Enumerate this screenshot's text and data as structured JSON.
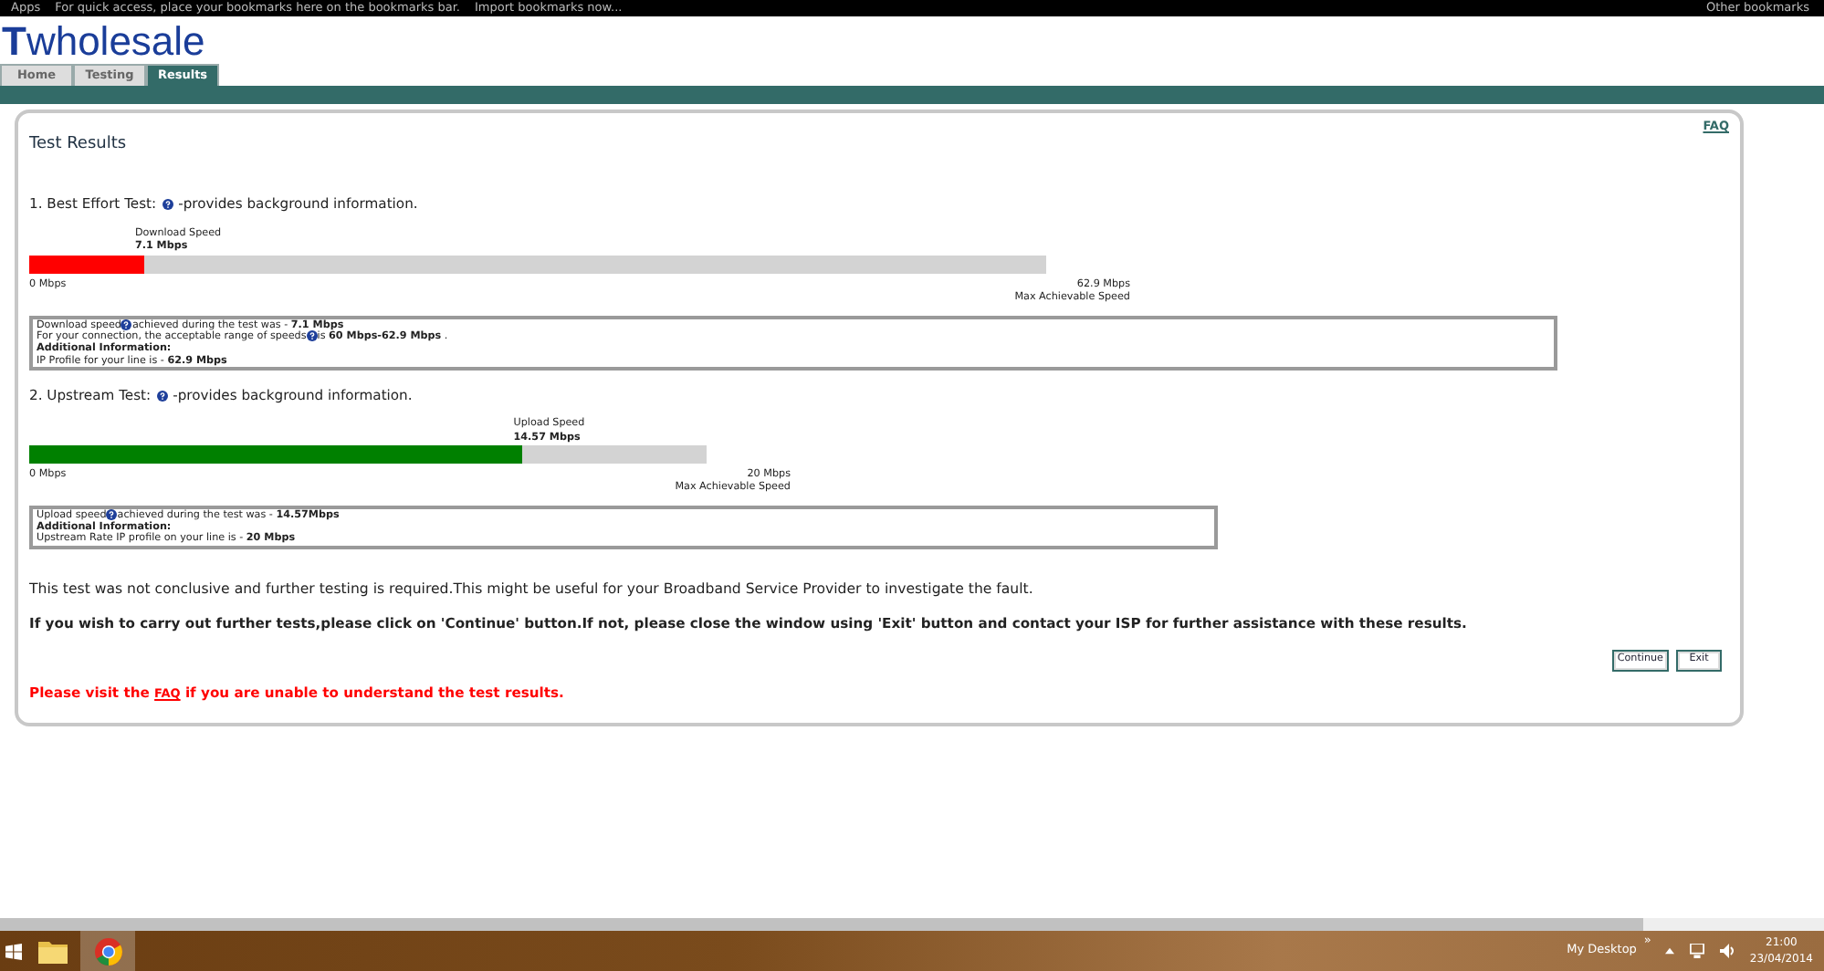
{
  "bookmarks_bar": {
    "apps": "Apps",
    "hint": "For quick access, place your bookmarks here on the bookmarks bar.",
    "import_link": "Import bookmarks now...",
    "other": "Other bookmarks"
  },
  "logo": {
    "mark": "T",
    "text": "wholesale"
  },
  "tabs": [
    {
      "label": "Home",
      "selected": false
    },
    {
      "label": "Testing",
      "selected": false
    },
    {
      "label": "Results",
      "selected": true
    }
  ],
  "panel": {
    "title": "Test Results",
    "faq_link": "FAQ",
    "tests": [
      {
        "heading": "1. Best Effort Test:",
        "note": "-provides background information.",
        "color": "#ff0000",
        "marker_label": "Download Speed",
        "marker_value": "7.1 Mbps",
        "level": 0.113,
        "min_label": "0 Mbps",
        "max_label": "62.9 Mbps",
        "max_caption": "Max Achievable Speed",
        "info": [
          {
            "kind": "help",
            "text": "Download speed",
            "after": "achieved during the test was - **7.1 Mbps**"
          },
          {
            "kind": "help",
            "text": "For your connection, the acceptable range of speeds",
            "after": "is **60 Mbps-62.9 Mbps** ."
          },
          {
            "kind": "heading",
            "text": "Additional Information:"
          },
          {
            "kind": "text",
            "text": "IP Profile for your line is - **62.9 Mbps**"
          }
        ]
      },
      {
        "heading": "2. Upstream Test:",
        "note": "-provides background information.",
        "color": "#008000",
        "marker_label": "Upload Speed",
        "marker_value": "14.57 Mbps",
        "level": 0.7285,
        "min_label": "0 Mbps",
        "max_label": "20 Mbps",
        "max_caption": "Max Achievable Speed",
        "info": [
          {
            "kind": "help",
            "text": "Upload speed",
            "after": "achieved during the test was - **14.57Mbps**"
          },
          {
            "kind": "heading",
            "text": "Additional Information:"
          },
          {
            "kind": "text",
            "text": "Upstream Rate IP profile on your line is - **20 Mbps**"
          }
        ]
      }
    ],
    "conclusion": "This test was not conclusive and further testing is required.This might be useful for your Broadband Service Provider to investigate the fault.",
    "instruction": "If you wish to carry out further tests,please click on 'Continue' button.If not, please close the window using 'Exit' button and contact your ISP for further assistance with these results.",
    "buttons": [
      "Continue",
      "Exit"
    ],
    "footer": {
      "before": "Please visit the",
      "link": "FAQ",
      "after": "if you are unable to understand the test results."
    }
  },
  "taskbar": {
    "toolbar_label": "My Desktop",
    "expand": "»",
    "time": "21:00",
    "date": "23/04/2014"
  }
}
